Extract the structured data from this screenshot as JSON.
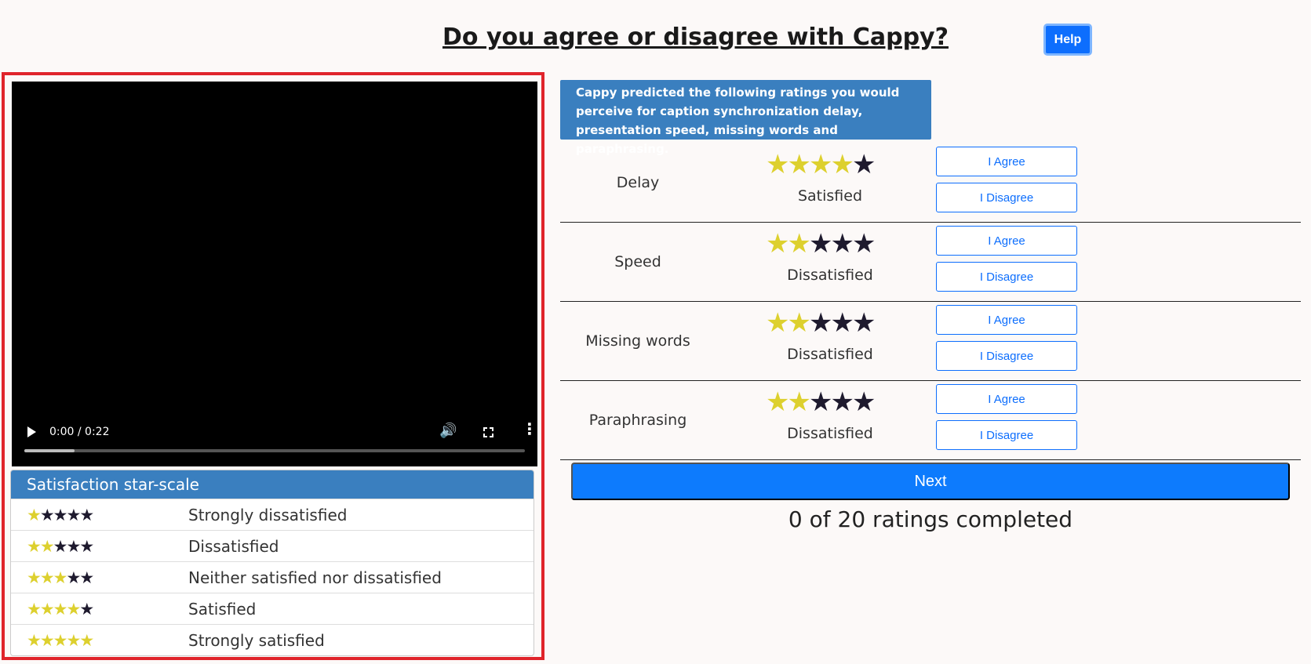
{
  "header": {
    "title": "Do you agree or disagree with Cappy?",
    "help_label": "Help"
  },
  "video": {
    "time": "0:00 / 0:22",
    "progress_fraction": 0.1
  },
  "scale": {
    "title": "Satisfaction star-scale",
    "rows": [
      {
        "stars": 1,
        "label": "Strongly dissatisfied"
      },
      {
        "stars": 2,
        "label": "Dissatisfied"
      },
      {
        "stars": 3,
        "label": "Neither satisfied nor dissatisfied"
      },
      {
        "stars": 4,
        "label": "Satisfied"
      },
      {
        "stars": 5,
        "label": "Strongly satisfied"
      }
    ]
  },
  "info": {
    "text": "Cappy predicted the following ratings you would perceive for caption synchronization delay, presentation speed, missing words and paraphrasing."
  },
  "ratings": [
    {
      "name": "Delay",
      "stars": 4,
      "desc": "Satisfied",
      "agree": "I Agree",
      "disagree": "I Disagree"
    },
    {
      "name": "Speed",
      "stars": 2,
      "desc": "Dissatisfied",
      "agree": "I Agree",
      "disagree": "I Disagree"
    },
    {
      "name": "Missing words",
      "stars": 2,
      "desc": "Dissatisfied",
      "agree": "I Agree",
      "disagree": "I Disagree"
    },
    {
      "name": "Paraphrasing",
      "stars": 2,
      "desc": "Dissatisfied",
      "agree": "I Agree",
      "disagree": "I Disagree"
    }
  ],
  "footer": {
    "next_label": "Next",
    "progress_text": "0 of 20 ratings completed"
  },
  "colors": {
    "star_on": "#ddd02e",
    "star_off": "#1e1a2e",
    "accent": "#0d6efd",
    "header_bg": "#3a7fbf",
    "highlight_border": "#e0242b"
  },
  "star_glyph": "★"
}
